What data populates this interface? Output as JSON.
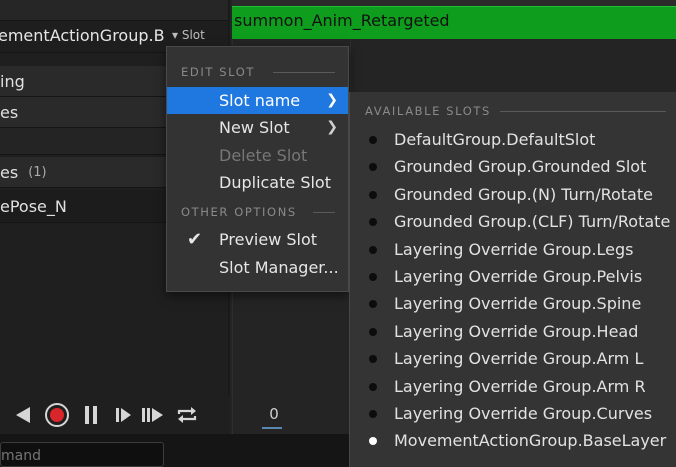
{
  "left_panel": {
    "group_text": "ementActionGroup.B",
    "slot_dropdown": "Slot",
    "rows": [
      "ing",
      "es",
      "",
      "es",
      "ePose_N"
    ],
    "count_badge": "(1)"
  },
  "timeline": {
    "track_name": "summon_Anim_Retargeted",
    "track_color": "#0f9d1d",
    "frame": "0"
  },
  "transport": {
    "icons": [
      "skip-back-icon",
      "record-icon",
      "pause-icon",
      "step-forward-icon",
      "skip-forward-icon",
      "loop-icon"
    ]
  },
  "command": {
    "placeholder": "mand"
  },
  "menu": {
    "edit_header": "EDIT SLOT",
    "items": [
      {
        "label": "Slot name",
        "selected": true,
        "submenu": true
      },
      {
        "label": "New Slot",
        "submenu": true
      },
      {
        "label": "Delete Slot",
        "disabled": true
      },
      {
        "label": "Duplicate Slot"
      }
    ],
    "other_header": "OTHER OPTIONS",
    "other_items": [
      {
        "label": "Preview Slot",
        "checked": true
      },
      {
        "label": "Slot Manager..."
      }
    ],
    "accent": "#1f77e0"
  },
  "submenu": {
    "header": "AVAILABLE SLOTS",
    "slots": [
      {
        "label": "DefaultGroup.DefaultSlot",
        "active": false
      },
      {
        "label": "Grounded Group.Grounded Slot",
        "active": false
      },
      {
        "label": "Grounded Group.(N) Turn/Rotate",
        "active": false
      },
      {
        "label": "Grounded Group.(CLF) Turn/Rotate",
        "active": false
      },
      {
        "label": "Layering Override Group.Legs",
        "active": false
      },
      {
        "label": "Layering Override Group.Pelvis",
        "active": false
      },
      {
        "label": "Layering Override Group.Spine",
        "active": false
      },
      {
        "label": "Layering Override Group.Head",
        "active": false
      },
      {
        "label": "Layering Override Group.Arm L",
        "active": false
      },
      {
        "label": "Layering Override Group.Arm R",
        "active": false
      },
      {
        "label": "Layering Override Group.Curves",
        "active": false
      },
      {
        "label": "MovementActionGroup.BaseLayer",
        "active": true
      }
    ]
  }
}
